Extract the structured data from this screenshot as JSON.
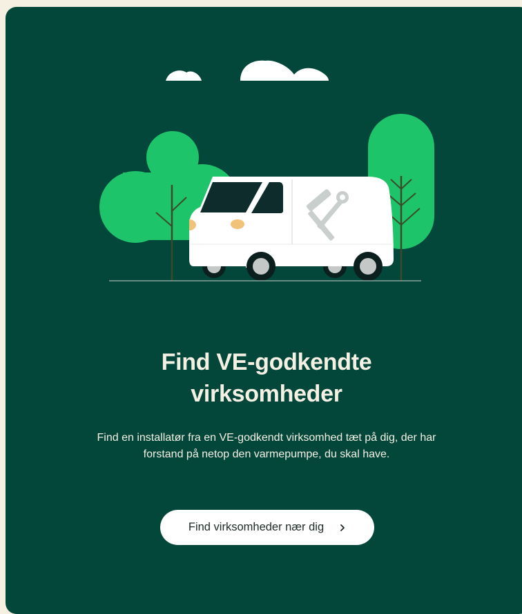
{
  "card": {
    "headline_line1": "Find VE-godkendte",
    "headline_line2": "virksomheder",
    "body": "Find en installatør fra en VE-godkendt virksomhed tæt på dig, der har forstand på netop den varmepumpe, du skal have.",
    "cta_label": "Find virksomheder nær dig",
    "cta_icon": "chevron-right-icon"
  },
  "illustration": {
    "name": "service-van-illustration",
    "colors": {
      "background": "#03473a",
      "tree": "#1ec46a",
      "trunk": "#3a4a2b",
      "van": "#ffffff",
      "window": "#0e2c2b",
      "headlight": "#f0c27a",
      "tool": "#c9cfcc",
      "tire": "#0b1f1e",
      "hubcap": "#c4c8c6",
      "ground": "#8aa39b",
      "cloud": "#ffffff"
    }
  }
}
